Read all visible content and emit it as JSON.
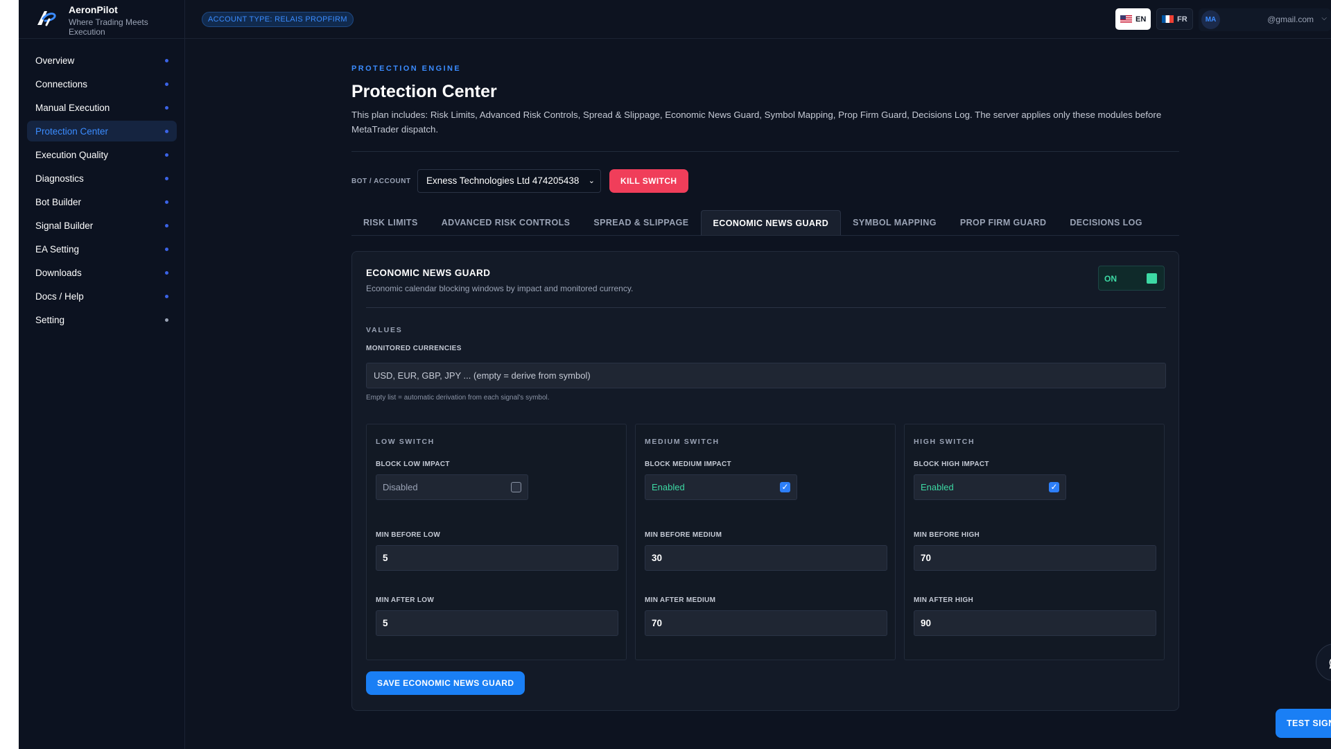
{
  "brand": {
    "name": "AeronPilot",
    "tagline": "Where Trading Meets Execution",
    "logo_icon": "ap-logo-icon"
  },
  "topbar": {
    "account_type": "ACCOUNT TYPE: RELAIS PROPFIRM",
    "languages": [
      {
        "code": "EN",
        "flag": "us-flag-icon",
        "active": true
      },
      {
        "code": "FR",
        "flag": "fr-flag-icon",
        "active": false
      }
    ],
    "user": {
      "initials": "MA",
      "email": "@gmail.com",
      "chevron": "chevron-down-icon"
    }
  },
  "sidebar": {
    "items": [
      {
        "label": "Overview"
      },
      {
        "label": "Connections"
      },
      {
        "label": "Manual Execution"
      },
      {
        "label": "Protection Center",
        "active": true
      },
      {
        "label": "Execution Quality"
      },
      {
        "label": "Diagnostics"
      },
      {
        "label": "Bot Builder"
      },
      {
        "label": "Signal Builder"
      },
      {
        "label": "EA Setting"
      },
      {
        "label": "Downloads"
      },
      {
        "label": "Docs / Help"
      },
      {
        "label": "Setting"
      }
    ]
  },
  "page": {
    "eyebrow": "PROTECTION ENGINE",
    "title": "Protection Center",
    "description": "This plan includes: Risk Limits, Advanced Risk Controls, Spread & Slippage, Economic News Guard, Symbol Mapping, Prop Firm Guard, Decisions Log. The server applies only these modules before MetaTrader dispatch."
  },
  "bot": {
    "label": "BOT / ACCOUNT",
    "selected": "Exness Technologies Ltd 474205438",
    "kill_label": "KILL SWITCH"
  },
  "tabs": [
    {
      "label": "RISK LIMITS"
    },
    {
      "label": "ADVANCED RISK CONTROLS"
    },
    {
      "label": "SPREAD & SLIPPAGE"
    },
    {
      "label": "ECONOMIC NEWS GUARD",
      "active": true
    },
    {
      "label": "SYMBOL MAPPING"
    },
    {
      "label": "PROP FIRM GUARD"
    },
    {
      "label": "DECISIONS LOG"
    }
  ],
  "guard": {
    "title": "ECONOMIC NEWS GUARD",
    "subtitle": "Economic calendar blocking windows by impact and monitored currency.",
    "toggle_label": "ON",
    "values_label": "VALUES",
    "currencies_label": "MONITORED CURRENCIES",
    "currencies_placeholder": "USD, EUR, GBP, JPY ... (empty = derive from symbol)",
    "currencies_hint": "Empty list = automatic derivation from each signal's symbol.",
    "switches": [
      {
        "head": "LOW SWITCH",
        "block_label": "BLOCK LOW IMPACT",
        "state": "Disabled",
        "checked": false,
        "before_label": "MIN BEFORE LOW",
        "before": "5",
        "after_label": "MIN AFTER LOW",
        "after": "5"
      },
      {
        "head": "MEDIUM SWITCH",
        "block_label": "BLOCK MEDIUM IMPACT",
        "state": "Enabled",
        "checked": true,
        "before_label": "MIN BEFORE MEDIUM",
        "before": "30",
        "after_label": "MIN AFTER MEDIUM",
        "after": "70"
      },
      {
        "head": "HIGH SWITCH",
        "block_label": "BLOCK HIGH IMPACT",
        "state": "Enabled",
        "checked": true,
        "before_label": "MIN BEFORE HIGH",
        "before": "70",
        "after_label": "MIN AFTER HIGH",
        "after": "90"
      }
    ],
    "save_label": "SAVE ECONOMIC NEWS GUARD"
  },
  "floating": {
    "chat_icon": "chat-bubble-icon",
    "test_label": "TEST SIGNAL"
  },
  "colors": {
    "accent": "#3b8cff",
    "danger": "#f03e5a",
    "success": "#3dd9a4",
    "background": "#0d1320"
  }
}
